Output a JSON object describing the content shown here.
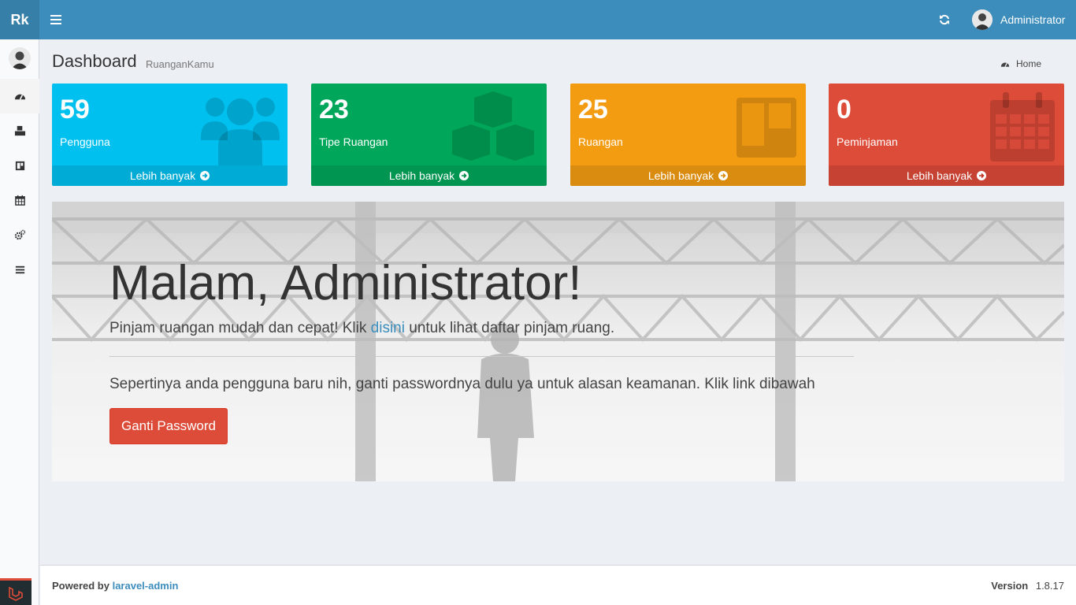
{
  "header": {
    "logo": "Rk",
    "user_name": "Administrator",
    "menu_icon": "bars-icon",
    "refresh_icon": "refresh-icon",
    "brand_color": "#3c8dbc"
  },
  "sidebar": {
    "items": [
      {
        "icon": "dashboard-icon"
      },
      {
        "icon": "cubes-icon"
      },
      {
        "icon": "trello-icon"
      },
      {
        "icon": "calendar-icon"
      },
      {
        "icon": "cogs-icon"
      },
      {
        "icon": "list-icon"
      }
    ]
  },
  "content_header": {
    "title": "Dashboard",
    "subtitle": "RuanganKamu",
    "breadcrumb": "Home"
  },
  "info_boxes": [
    {
      "value": "59",
      "label": "Pengguna",
      "more": "Lebih banyak",
      "color": "#00c0ef",
      "icon": "users-icon"
    },
    {
      "value": "23",
      "label": "Tipe Ruangan",
      "more": "Lebih banyak",
      "color": "#00a65a",
      "icon": "cubes-icon"
    },
    {
      "value": "25",
      "label": "Ruangan",
      "more": "Lebih banyak",
      "color": "#f39c12",
      "icon": "trello-icon"
    },
    {
      "value": "0",
      "label": "Peminjaman",
      "more": "Lebih banyak",
      "color": "#dd4b39",
      "icon": "calendar-icon"
    }
  ],
  "jumbotron": {
    "greeting": "Malam, Administrator!",
    "lead_before": "Pinjam ruangan mudah dan cepat! Klik ",
    "lead_link": "disini",
    "lead_after": " untuk lihat daftar pinjam ruang.",
    "notice": "Sepertinya anda pengguna baru nih, ganti passwordnya dulu ya untuk alasan keamanan. Klik link dibawah",
    "button": "Ganti Password"
  },
  "footer": {
    "powered_by": "Powered by",
    "link": "laravel-admin",
    "version_label": "Version",
    "version": "1.8.17"
  }
}
